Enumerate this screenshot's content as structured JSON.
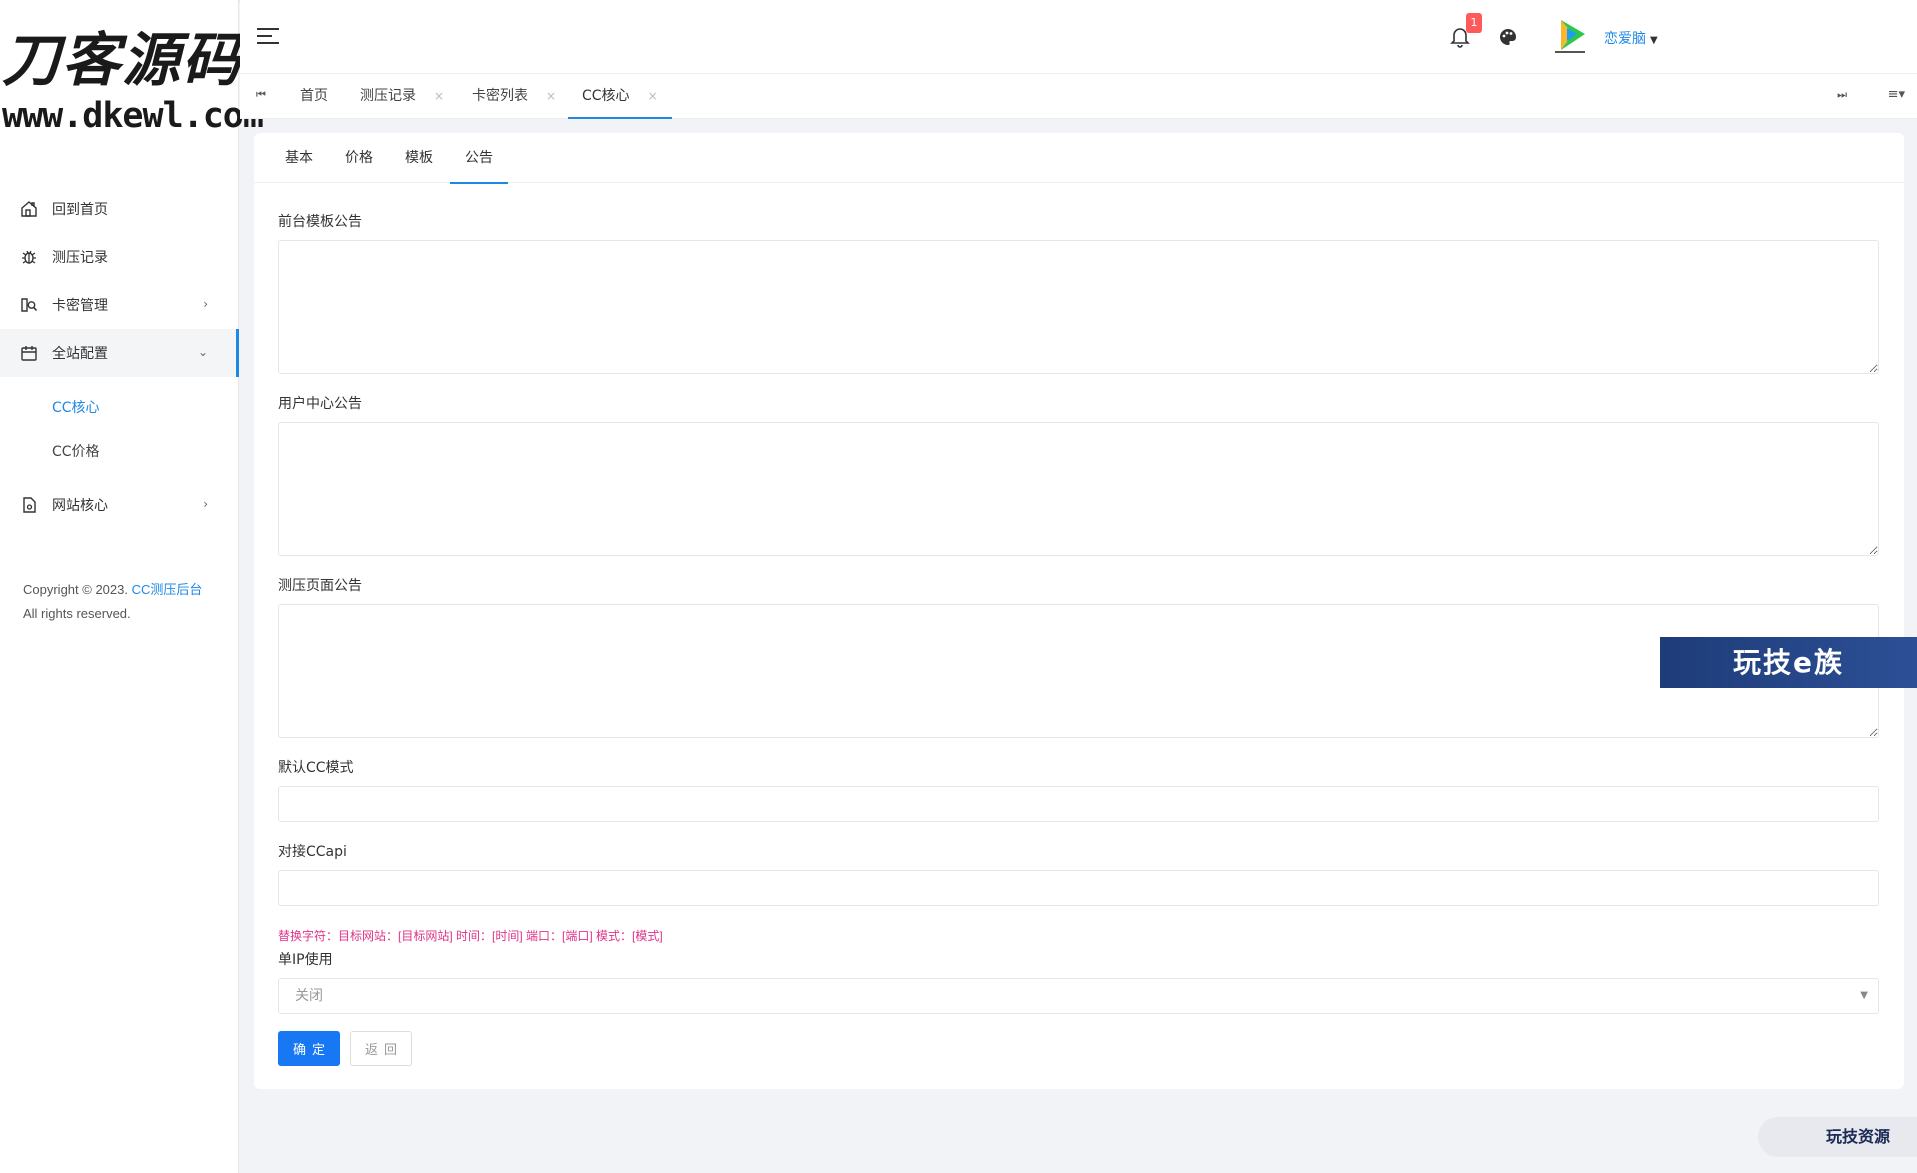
{
  "logo": {
    "line1": "刀客源码网",
    "line2": "www.dkewl.com"
  },
  "sidebar": {
    "items": [
      {
        "label": "回到首页",
        "icon": "home-icon"
      },
      {
        "label": "测压记录",
        "icon": "bug-icon"
      },
      {
        "label": "卡密管理",
        "icon": "card-icon",
        "arrow": "›"
      },
      {
        "label": "全站配置",
        "icon": "calendar-icon",
        "arrow": "⌄"
      },
      {
        "label": "网站核心",
        "icon": "file-icon",
        "arrow": "›"
      }
    ],
    "sub_items": [
      {
        "label": "CC核心"
      },
      {
        "label": "CC价格"
      }
    ],
    "copyright": {
      "prefix": "Copyright © 2023.",
      "brand": "CC测压后台",
      "line2": "All rights reserved."
    }
  },
  "header": {
    "notification_count": "1",
    "username": "恋爱脑"
  },
  "page_tabs": [
    {
      "label": "首页",
      "closable": false
    },
    {
      "label": "测压记录",
      "closable": true,
      "close": "×"
    },
    {
      "label": "卡密列表",
      "closable": true,
      "close": "×"
    },
    {
      "label": "CC核心",
      "closable": true,
      "close": "×",
      "active": true
    }
  ],
  "content_tabs": [
    "基本",
    "价格",
    "模板",
    "公告"
  ],
  "form": {
    "front_notice_label": "前台模板公告",
    "user_center_notice_label": "用户中心公告",
    "test_page_notice_label": "测压页面公告",
    "default_cc_mode_label": "默认CC模式",
    "dock_ccapi_label": "对接CCapi",
    "replace_hint": "替换字符：目标网站：[目标网站] 时间：[时间] 端口：[端口] 模式：[模式]",
    "single_ip_label": "单IP使用",
    "single_ip_value": "关闭",
    "confirm_label": "确定",
    "back_label": "返回"
  },
  "watermarks": {
    "banner": "玩技e族",
    "corner": "玩技资源"
  },
  "colors": {
    "accent": "#1e88e5",
    "primary_button": "#1877f2",
    "hint": "#e0338a",
    "badge": "#ff5a5a"
  }
}
